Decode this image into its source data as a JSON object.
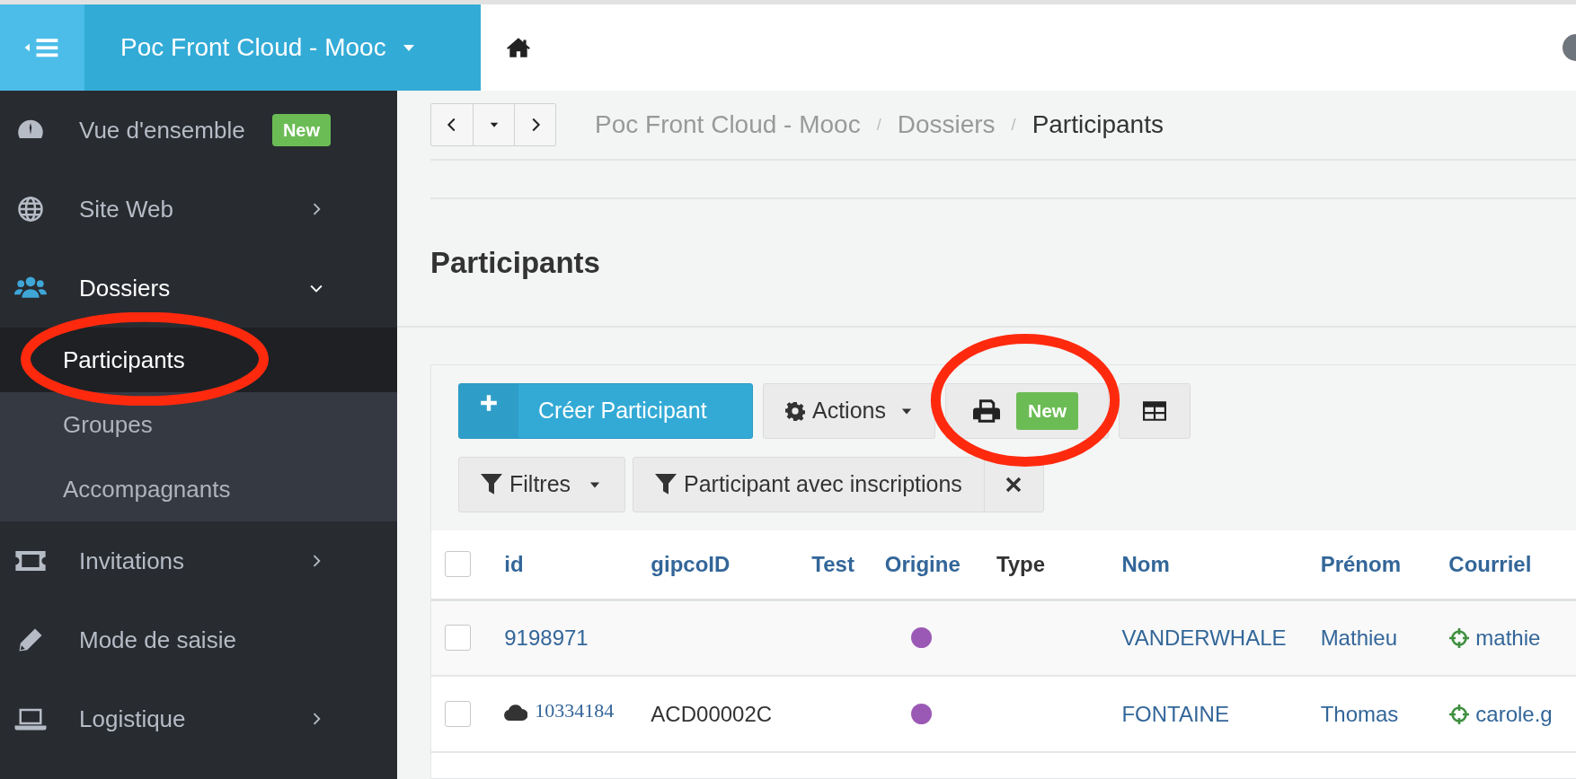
{
  "topbar": {
    "brand": "Poc Front Cloud - Mooc"
  },
  "sidebar": {
    "items": [
      {
        "label": "Vue d'ensemble",
        "badge": "New",
        "has_submenu": false,
        "expanded": false
      },
      {
        "label": "Site Web",
        "has_submenu": true,
        "expanded": false
      },
      {
        "label": "Dossiers",
        "has_submenu": true,
        "expanded": true,
        "children": [
          {
            "label": "Participants",
            "selected": true,
            "circled": true
          },
          {
            "label": "Groupes",
            "selected": false,
            "circled": false
          },
          {
            "label": "Accompagnants",
            "selected": false,
            "circled": false
          }
        ]
      },
      {
        "label": "Invitations",
        "has_submenu": true,
        "expanded": false
      },
      {
        "label": "Mode de saisie",
        "has_submenu": false,
        "expanded": false
      },
      {
        "label": "Logistique",
        "has_submenu": true,
        "expanded": false
      }
    ]
  },
  "breadcrumb": [
    {
      "label": "Poc Front Cloud - Mooc",
      "separator": "/"
    },
    {
      "label": "Dossiers",
      "separator": "/"
    },
    {
      "label": "Participants"
    }
  ],
  "page_title": "Participants",
  "toolbar": {
    "create_label": "Créer Participant",
    "actions_label": "Actions",
    "print_badge": "New",
    "print_circled": true
  },
  "filters": {
    "label": "Filtres",
    "active_filter": "Participant avec inscriptions"
  },
  "table": {
    "select_all_checked": false,
    "columns": [
      {
        "label": "id",
        "sortable": true
      },
      {
        "label": "gipcoID",
        "sortable": true
      },
      {
        "label": "Test",
        "sortable": true
      },
      {
        "label": "Origine",
        "sortable": true
      },
      {
        "label": "Type",
        "sortable": false
      },
      {
        "label": "Nom",
        "sortable": true
      },
      {
        "label": "Prénom",
        "sortable": true
      },
      {
        "label": "Courriel",
        "sortable": true
      }
    ],
    "rows": [
      {
        "checked": false,
        "cloud": false,
        "id": "9198971",
        "gipcoID": "",
        "color": "#9b59b6",
        "nom": "VANDERWHALE",
        "prenom": "Mathieu",
        "courriel": "mathie"
      },
      {
        "checked": false,
        "cloud": true,
        "id": "10334184",
        "gipcoID": "ACD00002C",
        "color": "#9b59b6",
        "nom": "FONTAINE",
        "prenom": "Thomas",
        "courriel": "carole.g"
      }
    ]
  }
}
